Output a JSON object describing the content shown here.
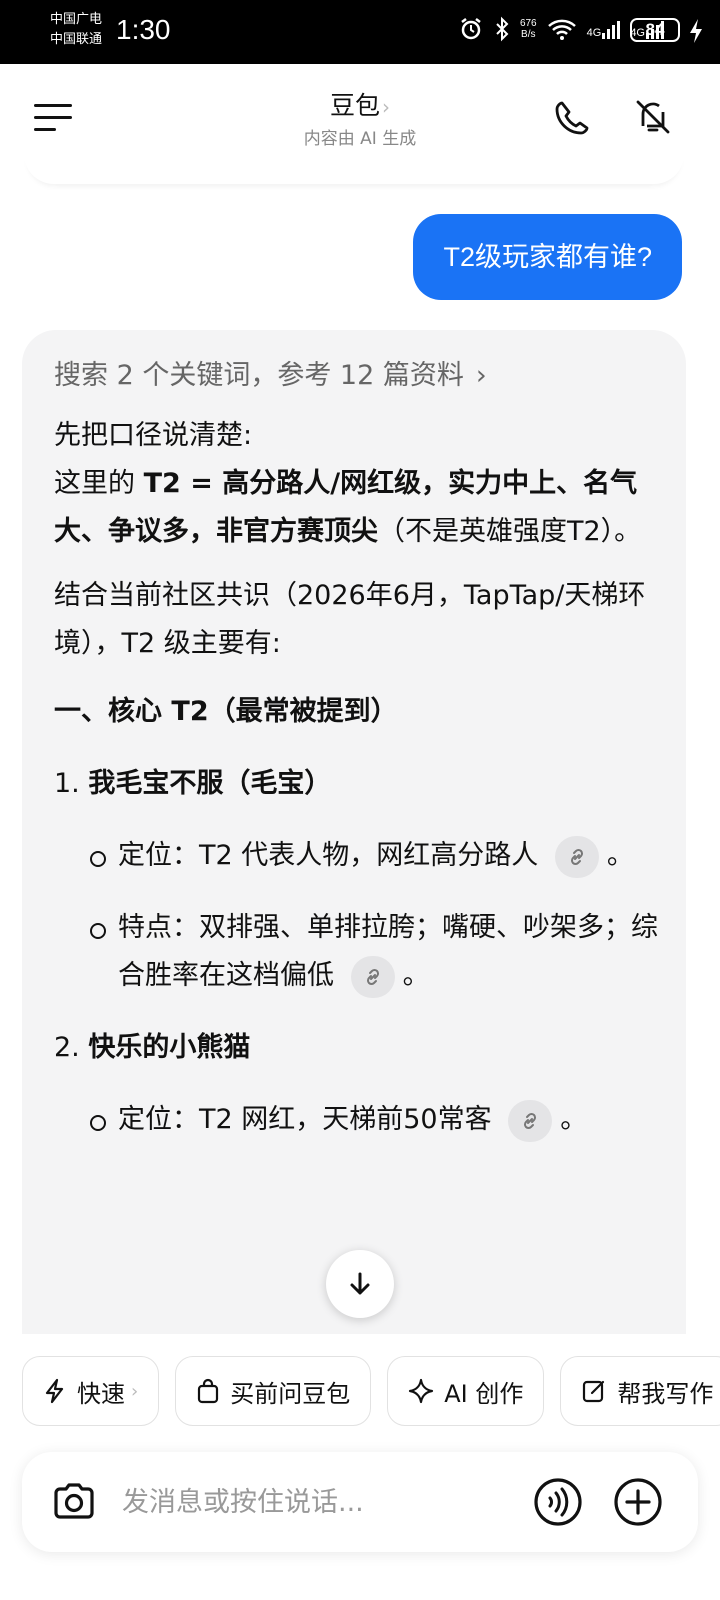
{
  "status_bar": {
    "carrier_1": "中国广电",
    "carrier_2": "中国联通",
    "time": "1:30",
    "net_speed_value": "676",
    "net_speed_unit": "B/s",
    "sim1_label": "4G",
    "sim2_label": "4G",
    "battery": "84"
  },
  "header": {
    "title": "豆包",
    "title_chevron": "›",
    "subtitle": "内容由 AI 生成",
    "icons": [
      "menu-icon",
      "phone-icon",
      "mute-icon"
    ]
  },
  "chat": {
    "user_message": "T2级玩家都有谁?",
    "answer": {
      "search_meta": "搜索 2 个关键词，参考 12 篇资料",
      "intro_line1": "先把口径说清楚:",
      "intro_line2_prefix": "这里的 ",
      "intro_line2_bold": "T2 = 高分路人/网红级，实力中上、名气大、争议多，非官方赛顶尖",
      "intro_line2_suffix": "（不是英雄强度T2）。",
      "context_para": "结合当前社区共识（2026年6月，TapTap/天梯环境），T2 级主要有:",
      "section_heading": "一、核心 T2（最常被提到）",
      "items": [
        {
          "number": "1.",
          "name": "我毛宝不服（毛宝）",
          "bullets": [
            {
              "text": "定位：T2 代表人物，网红高分路人",
              "end": "。"
            },
            {
              "text": "特点：双排强、单排拉胯；嘴硬、吵架多；综合胜率在这档偏低",
              "end": "。"
            }
          ]
        },
        {
          "number": "2.",
          "name": "快乐的小熊猫",
          "bullets": [
            {
              "text": "定位：T2 网红，天梯前50常客",
              "end": "。"
            }
          ]
        }
      ]
    }
  },
  "quick_actions": {
    "fast": "快速",
    "fast_chevron": "›",
    "buy": "买前问豆包",
    "ai_create": "AI 创作",
    "help_write": "帮我写作"
  },
  "input": {
    "placeholder": "发消息或按住说话..."
  },
  "colors": {
    "accent": "#1a73f5",
    "card_bg": "#f4f4f5",
    "cite_bg": "#e4e4e6"
  }
}
